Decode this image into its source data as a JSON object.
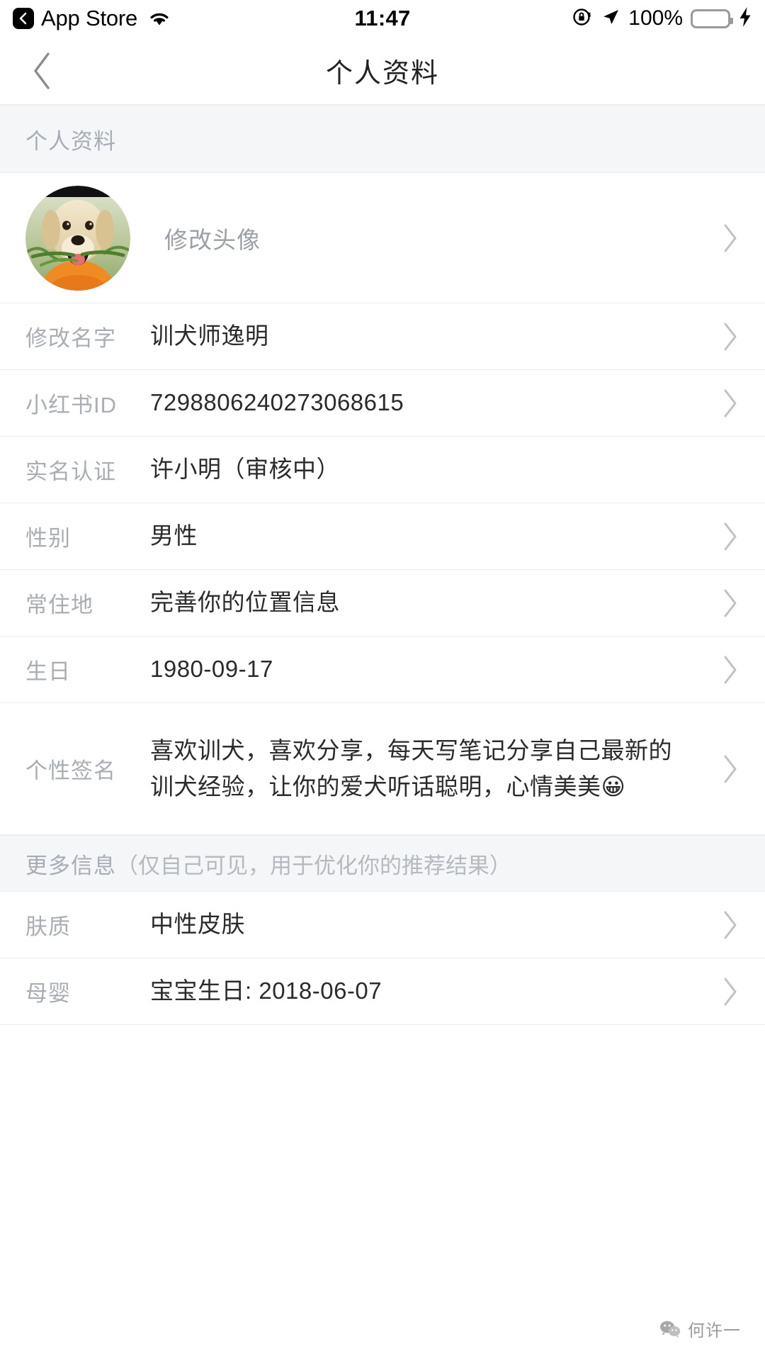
{
  "status_bar": {
    "back_app": "App Store",
    "time": "11:47",
    "battery_percent": "100%",
    "wifi_icon": "wifi-icon",
    "rotation_lock_icon": "rotation-lock-icon",
    "location_icon": "location-arrow-icon",
    "battery_icon": "battery-icon",
    "charging_icon": "lightning-bolt-icon",
    "battery_color": "#4cd964"
  },
  "navbar": {
    "back_icon": "chevron-left-icon",
    "title": "个人资料"
  },
  "sections": [
    {
      "header": "个人资料",
      "note": "",
      "rows": [
        {
          "label": "",
          "value": "修改头像",
          "type": "avatar",
          "chevron": true,
          "name": "avatar"
        },
        {
          "label": "修改名字",
          "value": "训犬师逸明",
          "type": "text",
          "chevron": true,
          "name": "name"
        },
        {
          "label": "小红书ID",
          "value": "7298806240273068615",
          "type": "text",
          "chevron": true,
          "name": "xhs-id"
        },
        {
          "label": "实名认证",
          "value": "许小明（审核中）",
          "type": "text",
          "chevron": false,
          "name": "real-name-verification"
        },
        {
          "label": "性别",
          "value": "男性",
          "type": "text",
          "chevron": true,
          "name": "gender"
        },
        {
          "label": "常住地",
          "value": "完善你的位置信息",
          "type": "text",
          "chevron": true,
          "name": "location"
        },
        {
          "label": "生日",
          "value": "1980-09-17",
          "type": "text",
          "chevron": true,
          "name": "birthday"
        },
        {
          "label": "个性签名",
          "value": "喜欢训犬，喜欢分享，每天写笔记分享自己最新的训犬经验，让你的爱犬听话聪明，心情美美😀",
          "type": "bio",
          "chevron": true,
          "name": "signature"
        }
      ]
    },
    {
      "header": "更多信息",
      "note": "（仅自己可见，用于优化你的推荐结果）",
      "rows": [
        {
          "label": "肤质",
          "value": "中性皮肤",
          "type": "text",
          "chevron": true,
          "name": "skin-type"
        },
        {
          "label": "母婴",
          "value": "宝宝生日: 2018-06-07",
          "type": "text",
          "chevron": true,
          "name": "maternal-infant"
        }
      ]
    }
  ],
  "watermark": {
    "text": "何许一",
    "logo_icon": "wechat-logo-icon"
  }
}
